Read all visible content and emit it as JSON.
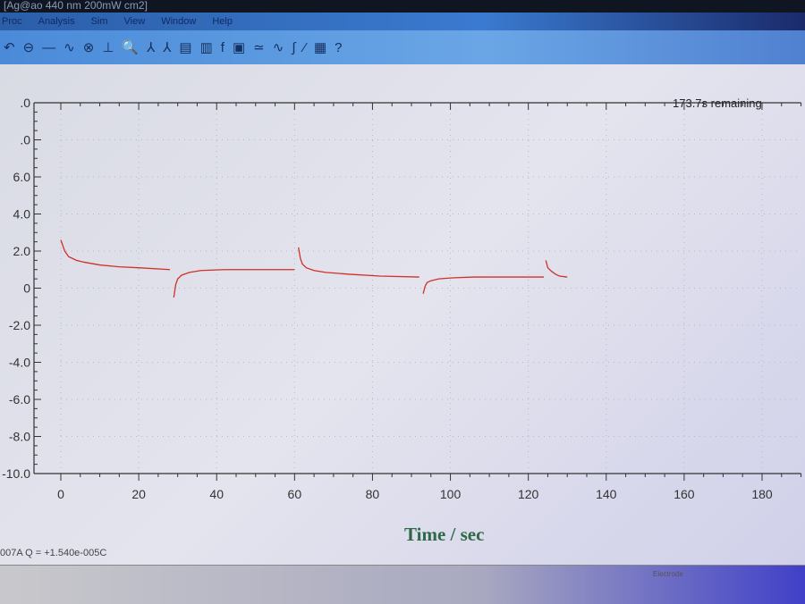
{
  "window": {
    "title": "[Ag@ao 440 nm 200mW cm2]"
  },
  "menu": [
    "Proc",
    "Analysis",
    "Sim",
    "View",
    "Window",
    "Help"
  ],
  "toolbar_icons": [
    "undo-icon",
    "zoom-out-icon",
    "line-icon",
    "curve-icon",
    "graph-icon",
    "axis-icon",
    "zoom-icon",
    "peak-icon",
    "peak2-icon",
    "data-icon",
    "bars-icon",
    "fp-icon",
    "clipboard-icon",
    "smooth-icon",
    "wave-icon",
    "fit-icon",
    "pen-icon",
    "list-icon",
    "help-icon"
  ],
  "status": {
    "remaining": "173.7s remaining",
    "readout": "007A  Q = +1.540e-005C",
    "electrode": "Electrode"
  },
  "colors": {
    "trace": "#d0302a",
    "axis": "#333333",
    "xlabel": "#2e6a4a"
  },
  "chart_data": {
    "type": "line",
    "title": "",
    "xlabel": "Time / sec",
    "ylabel": "",
    "xlim": [
      0,
      190
    ],
    "ylim": [
      -10,
      10
    ],
    "xticks": [
      "0",
      "20",
      "40",
      "60",
      "80",
      "100",
      "120",
      "140",
      "160",
      "180"
    ],
    "yticks": [
      ".0",
      ".0",
      "6.0",
      "4.0",
      "2.0",
      "0",
      "-2.0",
      "-4.0",
      "-6.0",
      "-8.0",
      "-10.0"
    ],
    "ytick_values": [
      10,
      8,
      6,
      4,
      2,
      0,
      -2,
      -4,
      -6,
      -8,
      -10
    ],
    "grid": true,
    "series": [
      {
        "name": "light-on-1",
        "x": [
          0,
          1,
          2,
          4,
          6,
          10,
          15,
          20,
          28
        ],
        "y": [
          2.6,
          2.0,
          1.7,
          1.5,
          1.4,
          1.25,
          1.15,
          1.1,
          1.0
        ]
      },
      {
        "name": "light-off-1",
        "x": [
          29,
          29.5,
          30,
          31,
          33,
          36,
          42,
          50,
          60
        ],
        "y": [
          -0.5,
          0.2,
          0.5,
          0.7,
          0.85,
          0.95,
          1.0,
          1.0,
          1.0
        ]
      },
      {
        "name": "light-on-2",
        "x": [
          61,
          61.5,
          62,
          63,
          65,
          68,
          74,
          82,
          92
        ],
        "y": [
          2.2,
          1.6,
          1.3,
          1.1,
          0.95,
          0.85,
          0.75,
          0.65,
          0.6
        ]
      },
      {
        "name": "light-off-2",
        "x": [
          93,
          93.5,
          94,
          95,
          97,
          100,
          106,
          114,
          124
        ],
        "y": [
          -0.3,
          0.1,
          0.3,
          0.4,
          0.5,
          0.55,
          0.6,
          0.6,
          0.6
        ]
      },
      {
        "name": "light-on-3",
        "x": [
          124.5,
          125,
          126,
          127,
          128,
          130
        ],
        "y": [
          1.5,
          1.1,
          0.9,
          0.75,
          0.65,
          0.6
        ]
      }
    ]
  }
}
